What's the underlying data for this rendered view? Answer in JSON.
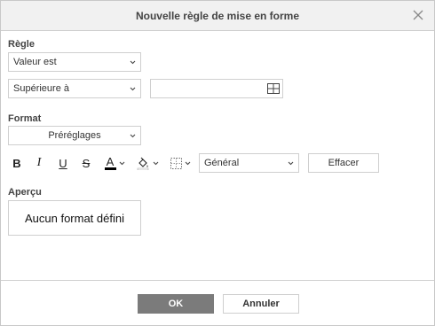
{
  "dialog": {
    "title": "Nouvelle règle de mise en forme",
    "close_icon": "close-icon"
  },
  "rule": {
    "section_label": "Règle",
    "rule_type": "Valeur est",
    "operator": "Supérieure à",
    "value": "",
    "range_icon": "select-range-icon"
  },
  "format": {
    "section_label": "Format",
    "presets": "Préréglages",
    "bold": "B",
    "italic": "I",
    "underline": "U",
    "strikethrough": "S",
    "font_color_letter": "A",
    "font_color": "#000000",
    "fill_icon": "fill-color-icon",
    "borders_icon": "borders-icon",
    "number_format": "Général",
    "clear_label": "Effacer"
  },
  "preview": {
    "section_label": "Aperçu",
    "text": "Aucun format défini"
  },
  "footer": {
    "ok_label": "OK",
    "cancel_label": "Annuler"
  }
}
